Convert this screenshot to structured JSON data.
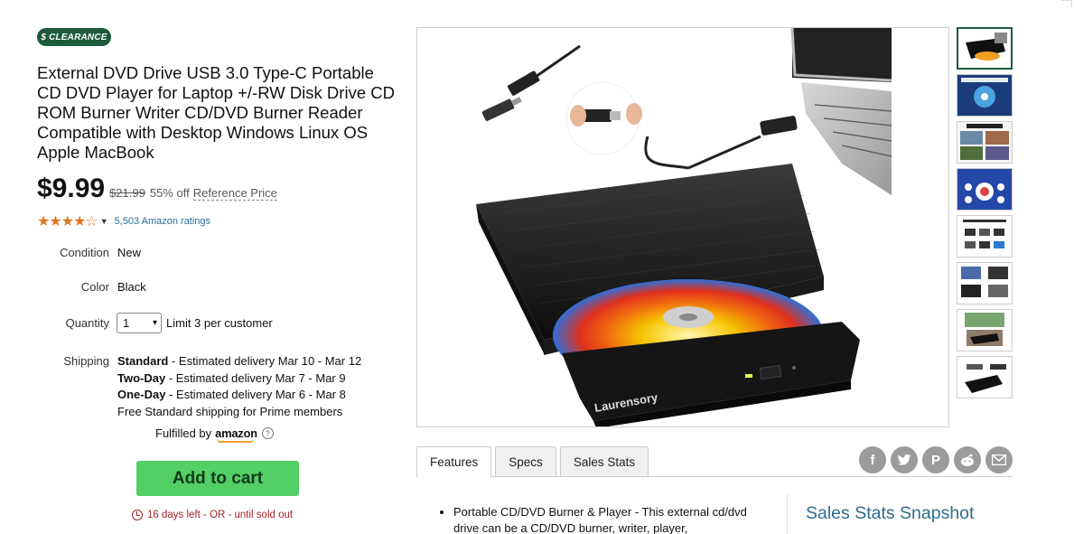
{
  "badge": "$ CLEARANCE",
  "product": {
    "title": "External DVD Drive USB 3.0 Type-C Portable CD DVD Player for Laptop +/-RW Disk Drive CD ROM Burner Writer CD/DVD Burner Reader Compatible with Desktop Windows Linux OS Apple MacBook",
    "price": "$9.99",
    "old_price": "$21.99",
    "discount": "55% off",
    "reference_price_label": "Reference Price",
    "rating_stars": "★★★★☆",
    "rating_value": 4.2,
    "ratings_count": "5,503 Amazon ratings"
  },
  "details": {
    "condition_label": "Condition",
    "condition_value": "New",
    "color_label": "Color",
    "color_value": "Black",
    "quantity_label": "Quantity",
    "quantity_value": "1",
    "quantity_limit": "Limit 3 per customer",
    "shipping_label": "Shipping",
    "shipping_options": [
      {
        "name": "Standard",
        "desc": " - Estimated delivery Mar 10 - Mar 12"
      },
      {
        "name": "Two-Day",
        "desc": " - Estimated delivery Mar 7 - Mar 9"
      },
      {
        "name": "One-Day",
        "desc": " - Estimated delivery Mar 6 - Mar 8"
      }
    ],
    "free_shipping": "Free Standard shipping for Prime members",
    "fulfilled_by": "Fulfilled by",
    "fulfilled_brand": "amazon"
  },
  "add_to_cart": "Add to cart",
  "timer_text": "16 days left - OR - until sold out",
  "image_brand": "Laurensory",
  "tabs": [
    "Features",
    "Specs",
    "Sales Stats"
  ],
  "social_icons": [
    "facebook-icon",
    "twitter-icon",
    "pinterest-icon",
    "reddit-icon",
    "email-icon"
  ],
  "features": {
    "first_line": "Portable CD/DVD Burner & Player - This external cd/dvd drive can be a CD/DVD burner, writer, player,"
  },
  "snapshot_title": "Sales Stats Snapshot",
  "colors": {
    "badge_bg": "#1d5a3c",
    "cart_button": "#53cf65",
    "timer": "#a3232a",
    "link": "#2a6f99",
    "star": "#de7921"
  }
}
